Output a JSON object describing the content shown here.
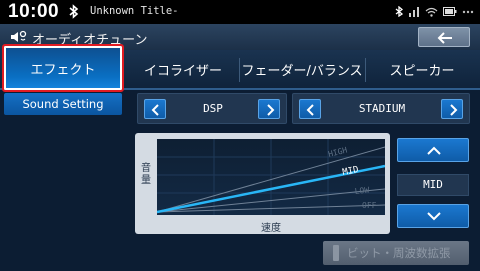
{
  "status": {
    "time": "10:00",
    "track_title": "Unknown Title-",
    "icons": [
      "bluetooth-icon",
      "signal-icon",
      "wifi-icon",
      "battery-icon",
      "more-icon"
    ]
  },
  "header": {
    "title": "オーディオチューン",
    "back_icon": "back-arrow-icon"
  },
  "tabs": [
    {
      "label": "エフェクト",
      "active": true
    },
    {
      "label": "イコライザー",
      "active": false
    },
    {
      "label": "フェーダー/バランス",
      "active": false
    },
    {
      "label": "スピーカー",
      "active": false
    }
  ],
  "submenu": {
    "label": "Sound Setting"
  },
  "selectors": {
    "mode": {
      "value": "DSP"
    },
    "preset": {
      "value": "STADIUM"
    }
  },
  "graph": {
    "ylabel_1": "音",
    "ylabel_2": "量",
    "xlabel": "速度",
    "levels": [
      "HIGH",
      "MID",
      "LOW",
      "OFF"
    ],
    "selected_level": "MID"
  },
  "level_control": {
    "value": "MID"
  },
  "extension_button": {
    "label": "ビット・周波数拡張",
    "enabled": false
  },
  "colors": {
    "accent": "#0a6fc3",
    "highlight_border": "#e11b22",
    "active_line": "#29b6f6"
  }
}
